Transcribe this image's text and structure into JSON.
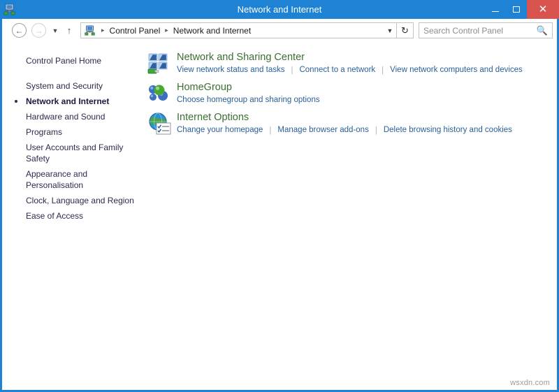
{
  "window": {
    "title": "Network and Internet",
    "icon": "control-panel-network-icon",
    "colors": {
      "titlebar": "#1e83d4",
      "close_button": "#d9534f",
      "heading": "#3a7030",
      "link": "#2a6099",
      "sidebar_text": "#2b2b4d"
    },
    "controls": {
      "minimize": "–",
      "maximize": "▢",
      "close": "✕"
    }
  },
  "navbar": {
    "back": "back-arrow",
    "forward": "forward-arrow",
    "recent": "recent-locations-chevron",
    "up": "up-arrow",
    "breadcrumbs": [
      {
        "label": "Control Panel"
      },
      {
        "label": "Network and Internet"
      }
    ],
    "breadcrumb_separator": "▸",
    "dropdown": "address-dropdown-chevron",
    "refresh": "refresh-icon",
    "search": {
      "placeholder": "Search Control Panel",
      "value": "",
      "icon": "search-icon"
    }
  },
  "sidebar": {
    "items": [
      {
        "label": "Control Panel Home",
        "selected": false,
        "home": true
      },
      {
        "label": "System and Security",
        "selected": false,
        "home": false
      },
      {
        "label": "Network and Internet",
        "selected": true,
        "home": false
      },
      {
        "label": "Hardware and Sound",
        "selected": false,
        "home": false
      },
      {
        "label": "Programs",
        "selected": false,
        "home": false
      },
      {
        "label": "User Accounts and Family Safety",
        "selected": false,
        "home": false
      },
      {
        "label": "Appearance and Personalisation",
        "selected": false,
        "home": false
      },
      {
        "label": "Clock, Language and Region",
        "selected": false,
        "home": false
      },
      {
        "label": "Ease of Access",
        "selected": false,
        "home": false
      }
    ]
  },
  "content": {
    "categories": [
      {
        "title": "Network and Sharing Center",
        "icon": "network-sharing-center-icon",
        "links": [
          "View network status and tasks",
          "Connect to a network",
          "View network computers and devices"
        ]
      },
      {
        "title": "HomeGroup",
        "icon": "homegroup-icon",
        "links": [
          "Choose homegroup and sharing options"
        ]
      },
      {
        "title": "Internet Options",
        "icon": "internet-options-icon",
        "links": [
          "Change your homepage",
          "Manage browser add-ons",
          "Delete browsing history and cookies"
        ]
      }
    ]
  },
  "watermark": "wsxdn.com"
}
